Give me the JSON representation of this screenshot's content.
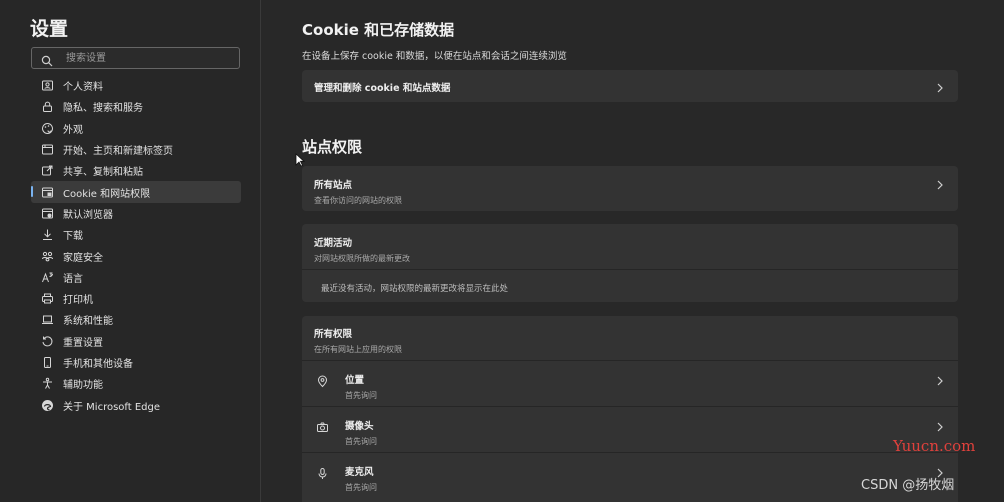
{
  "sidebar": {
    "title": "设置",
    "search_placeholder": "搜索设置",
    "items": [
      {
        "label": "个人资料",
        "icon": "profile-icon"
      },
      {
        "label": "隐私、搜索和服务",
        "icon": "lock-icon"
      },
      {
        "label": "外观",
        "icon": "appearance-icon"
      },
      {
        "label": "开始、主页和新建标签页",
        "icon": "home-tab-icon"
      },
      {
        "label": "共享、复制和粘贴",
        "icon": "share-icon"
      },
      {
        "label": "Cookie 和网站权限",
        "icon": "site-permissions-icon",
        "active": true
      },
      {
        "label": "默认浏览器",
        "icon": "default-browser-icon"
      },
      {
        "label": "下载",
        "icon": "download-icon"
      },
      {
        "label": "家庭安全",
        "icon": "family-icon"
      },
      {
        "label": "语言",
        "icon": "language-icon"
      },
      {
        "label": "打印机",
        "icon": "printer-icon"
      },
      {
        "label": "系统和性能",
        "icon": "laptop-icon"
      },
      {
        "label": "重置设置",
        "icon": "reset-icon"
      },
      {
        "label": "手机和其他设备",
        "icon": "phone-icon"
      },
      {
        "label": "辅助功能",
        "icon": "accessibility-icon"
      },
      {
        "label": "关于 Microsoft Edge",
        "icon": "edge-icon"
      }
    ]
  },
  "cookies": {
    "title": "Cookie 和已存储数据",
    "description": "在设备上保存 cookie 和数据，以便在站点和会话之间连续浏览",
    "manage_label": "管理和删除 cookie 和站点数据"
  },
  "permissions": {
    "title": "站点权限",
    "all_sites": {
      "title": "所有站点",
      "subtitle": "查看你访问的网站的权限"
    },
    "recent": {
      "title": "近期活动",
      "subtitle": "对网站权限所做的最新更改",
      "empty_message": "最近没有活动，网站权限的最新更改将显示在此处"
    },
    "all_permissions": {
      "title": "所有权限",
      "subtitle": "在所有网站上应用的权限",
      "items": [
        {
          "title": "位置",
          "subtitle": "首先询问",
          "icon": "location-icon"
        },
        {
          "title": "摄像头",
          "subtitle": "首先询问",
          "icon": "camera-icon"
        },
        {
          "title": "麦克风",
          "subtitle": "首先询问",
          "icon": "microphone-icon"
        }
      ]
    }
  },
  "watermarks": {
    "yuucn": "Yuucn.com",
    "csdn": "CSDN @扬牧烟"
  },
  "colors": {
    "background": "#282828",
    "card": "#333333",
    "accent": "#7ab3f0",
    "watermark_red": "#e0413c"
  }
}
